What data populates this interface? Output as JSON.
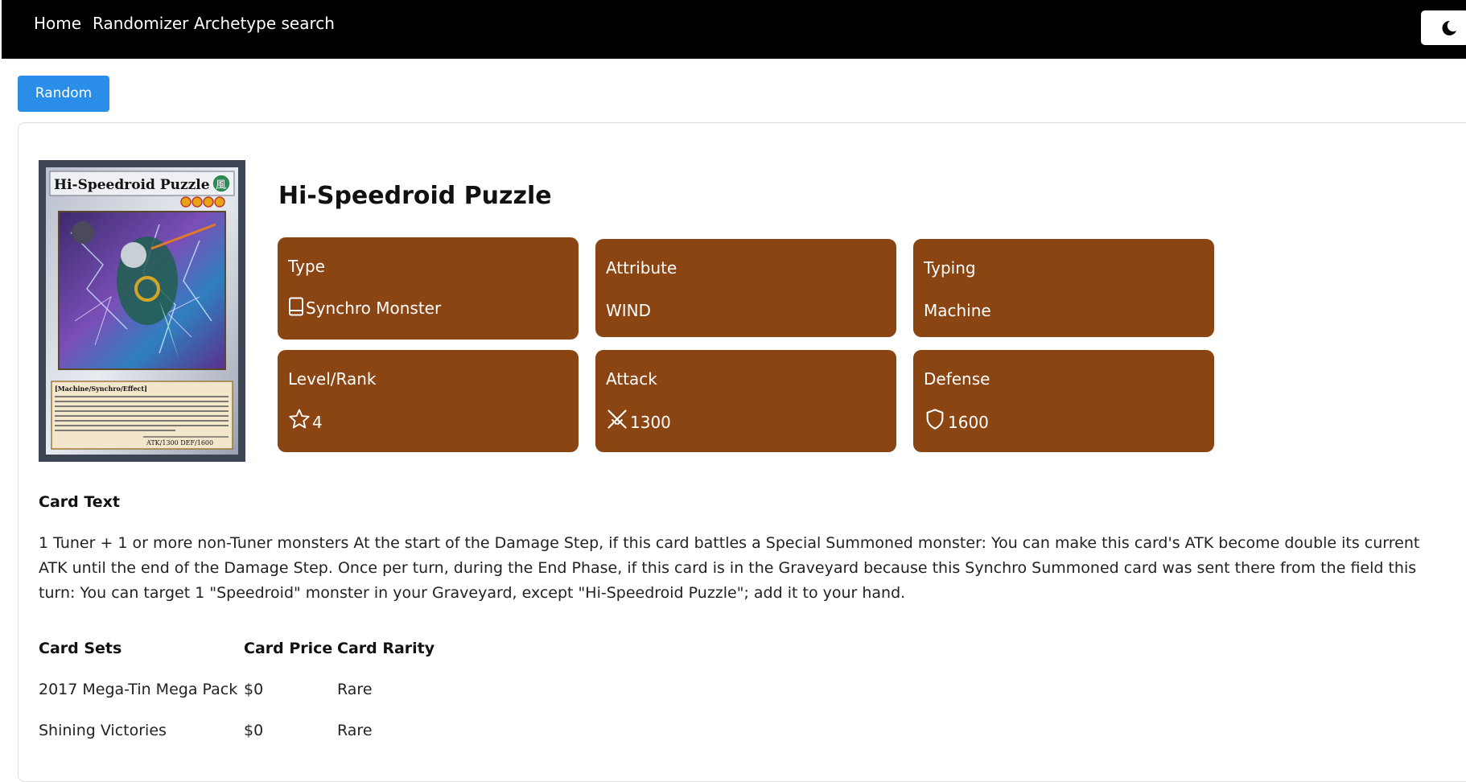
{
  "nav": {
    "links": [
      "Home",
      "Randomizer",
      "Archetype search"
    ]
  },
  "icons": {
    "theme_toggle": "moon-icon",
    "type": "book-icon",
    "level": "star-icon",
    "attack": "crossed-swords-icon",
    "defense": "shield-icon"
  },
  "colors": {
    "navbar": "#000000",
    "accent_button": "#2a8ee8",
    "stat_tile": "#8b4513"
  },
  "toolbar": {
    "random_label": "Random"
  },
  "card": {
    "name": "Hi-Speedroid Puzzle",
    "image": {
      "title": "Hi-Speedroid Puzzle",
      "attribute_glyph": "風",
      "stars": 4,
      "type_line": "[Machine/Synchro/Effect]",
      "atk_def": "ATK/1300  DEF/1600"
    },
    "stats": [
      {
        "label": "Type",
        "value": "Synchro Monster",
        "icon": "book-icon"
      },
      {
        "label": "Attribute",
        "value": "WIND"
      },
      {
        "label": "Typing",
        "value": "Machine"
      },
      {
        "label": "Level/Rank",
        "value": "4",
        "icon": "star-icon"
      },
      {
        "label": "Attack",
        "value": "1300",
        "icon": "crossed-swords-icon"
      },
      {
        "label": "Defense",
        "value": "1600",
        "icon": "shield-icon"
      }
    ],
    "text_heading": "Card Text",
    "text": "1 Tuner + 1 or more non-Tuner monsters At the start of the Damage Step, if this card battles a Special Summoned monster: You can make this card's ATK become double its current ATK until the end of the Damage Step. Once per turn, during the End Phase, if this card is in the Graveyard because this Synchro Summoned card was sent there from the field this turn: You can target 1 \"Speedroid\" monster in your Graveyard, except \"Hi-Speedroid Puzzle\"; add it to your hand."
  },
  "sets_table": {
    "headers": [
      "Card Sets",
      "Card Price",
      "Card Rarity"
    ],
    "rows": [
      [
        "2017 Mega-Tin Mega Pack",
        "$0",
        "Rare"
      ],
      [
        "Shining Victories",
        "$0",
        "Rare"
      ]
    ]
  }
}
